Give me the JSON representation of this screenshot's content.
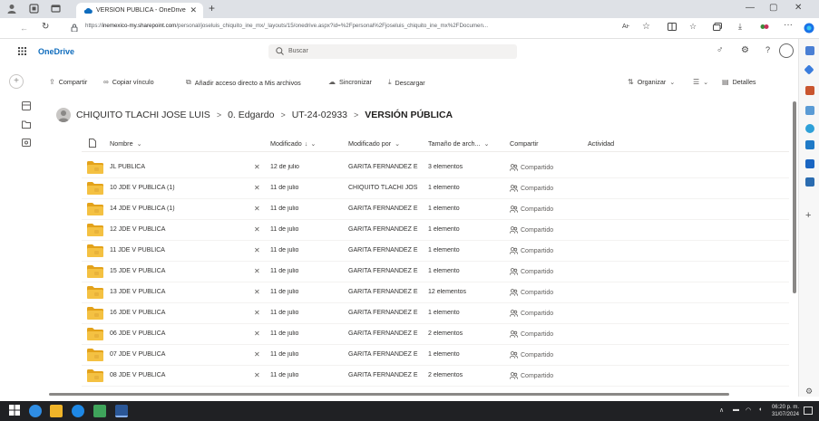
{
  "browser": {
    "tab_title": "VERSIÓN PÚBLICA - OneDrive",
    "url_prefix": "https://",
    "url_host": "inemexico-my.sharepoint.com",
    "url_path": "/personal/joseluis_chiquito_ine_mx/_layouts/15/onedrive.aspx?id=%2Fpersonal%2Fjoseluis_chiquito_ine_mx%2FDocumen...",
    "reader_label": "Aͱ"
  },
  "header": {
    "brand": "OneDrive",
    "search_placeholder": "Buscar"
  },
  "commands": {
    "share": "Compartir",
    "copy_link": "Copiar vínculo",
    "add_shortcut": "Añadir acceso directo a Mis archivos",
    "sync": "Sincronizar",
    "download": "Descargar",
    "organize": "Organizar",
    "details": "Detalles"
  },
  "breadcrumb": {
    "owner": "CHIQUITO TLACHI JOSE LUIS",
    "level1": "0. Edgardo",
    "level2": "UT-24-02933",
    "current": "VERSIÓN PÚBLICA",
    "sep": ">"
  },
  "columns": {
    "name": "Nombre",
    "modified": "Modificado",
    "modified_by": "Modificado por",
    "size": "Tamaño de arch...",
    "sharing": "Compartir",
    "activity": "Actividad"
  },
  "rows": [
    {
      "name": "JL PÚBLICA",
      "modified": "12 de julio",
      "by": "GARITA FERNANDEZ E",
      "size": "3 elementos",
      "sharing": "Compartido"
    },
    {
      "name": "10 JDE V PÚBLICA (1)",
      "modified": "11 de julio",
      "by": "CHIQUITO TLACHI JOS",
      "size": "1 elemento",
      "sharing": "Compartido"
    },
    {
      "name": "14 JDE V PÚBLICA (1)",
      "modified": "11 de julio",
      "by": "GARITA FERNANDEZ E",
      "size": "1 elemento",
      "sharing": "Compartido"
    },
    {
      "name": "12 JDE V PUBLICA",
      "modified": "11 de julio",
      "by": "GARITA FERNANDEZ E",
      "size": "1 elemento",
      "sharing": "Compartido"
    },
    {
      "name": "11 JDE V PÚBLICA",
      "modified": "11 de julio",
      "by": "GARITA FERNANDEZ E",
      "size": "1 elemento",
      "sharing": "Compartido"
    },
    {
      "name": "15 JDE V PÚBLICA",
      "modified": "11 de julio",
      "by": "GARITA FERNANDEZ E",
      "size": "1 elemento",
      "sharing": "Compartido"
    },
    {
      "name": "13 JDE V PÚBLICA",
      "modified": "11 de julio",
      "by": "GARITA FERNANDEZ E",
      "size": "12 elementos",
      "sharing": "Compartido"
    },
    {
      "name": "16 JDE V PÚBLICA",
      "modified": "11 de julio",
      "by": "GARITA FERNANDEZ E",
      "size": "1 elemento",
      "sharing": "Compartido"
    },
    {
      "name": "06 JDE V PÚBLICA",
      "modified": "11 de julio",
      "by": "GARITA FERNANDEZ E",
      "size": "2 elementos",
      "sharing": "Compartido"
    },
    {
      "name": "07 JDE V PÚBLICA",
      "modified": "11 de julio",
      "by": "GARITA FERNANDEZ E",
      "size": "1 elemento",
      "sharing": "Compartido"
    },
    {
      "name": "08 JDE V PÚBLICA",
      "modified": "11 de julio",
      "by": "GARITA FERNANDEZ E",
      "size": "2 elementos",
      "sharing": "Compartido"
    }
  ],
  "taskbar": {
    "time": "06:20 p. m.",
    "date": "31/07/2024"
  },
  "colors": {
    "brand_blue": "#0f6cbd",
    "folder_yellow": "#f4c142",
    "folder_dark": "#e3a21a",
    "taskbar": "#202124"
  }
}
